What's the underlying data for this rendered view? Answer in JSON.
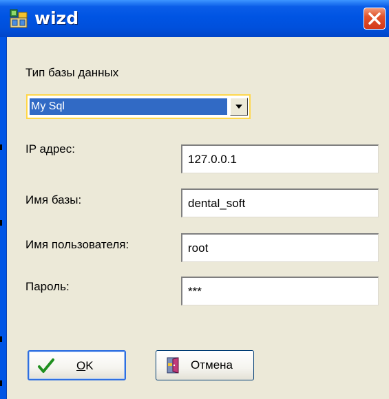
{
  "window": {
    "title": "wizd",
    "icon": "app-icon",
    "close_icon": "close-icon",
    "accent_color": "#0054e3",
    "background_color": "#ece9d8"
  },
  "form": {
    "db_type_label": "Тип базы данных",
    "db_type_selected": "My Sql",
    "ip_label": "IP адрес:",
    "ip_value": "127.0.0.1",
    "db_name_label": "Имя базы:",
    "db_name_value": "dental_soft",
    "user_label": "Имя пользователя:",
    "user_value": "root",
    "password_label": "Пароль:",
    "password_value": "***"
  },
  "buttons": {
    "ok_mnemonic": "O",
    "ok_rest": "K",
    "ok_icon": "checkmark-icon",
    "cancel_label": "Отмена",
    "cancel_icon": "door-exit-icon"
  }
}
